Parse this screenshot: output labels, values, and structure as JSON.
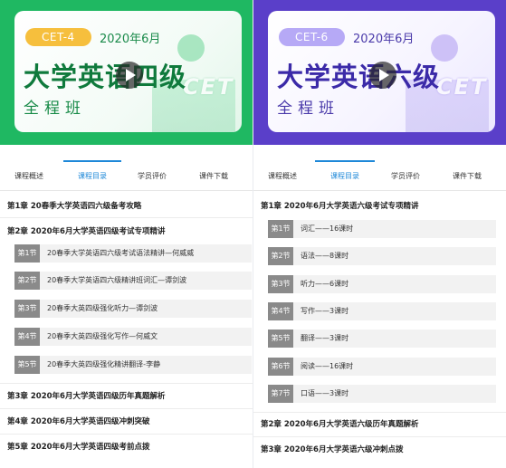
{
  "left": {
    "banner": {
      "level": "CET-4",
      "date": "2020年6月",
      "title": "大学英语四级",
      "subtitle": "全程班",
      "watermark": "CET"
    },
    "tabs": [
      "课程概述",
      "课程目录",
      "学员评价",
      "课件下载"
    ],
    "active_tab": 1,
    "ch1": "第1章 20春季大学英语四六级备考攻略",
    "ch2": "第2章 2020年6月大学英语四级考试专项精讲",
    "lessons": [
      {
        "badge": "第1节",
        "text": "20春季大学英语四六级考试语法精讲—何威威"
      },
      {
        "badge": "第2节",
        "text": "20春季大学英语四六级精讲班词汇—谭剑波"
      },
      {
        "badge": "第3节",
        "text": "20春季大英四级强化听力—谭剑波"
      },
      {
        "badge": "第4节",
        "text": "20春季大英四级强化写作—何威文"
      },
      {
        "badge": "第5节",
        "text": "20春季大英四级强化精讲翻译-李静"
      }
    ],
    "ch3": "第3章 2020年6月大学英语四级历年真题解析",
    "ch4": "第4章 2020年6月大学英语四级冲刺突破",
    "ch5": "第5章 2020年6月大学英语四级考前点拨"
  },
  "right": {
    "banner": {
      "level": "CET-6",
      "date": "2020年6月",
      "title": "大学英语六级",
      "subtitle": "全程班",
      "watermark": "CET"
    },
    "tabs": [
      "课程概述",
      "课程目录",
      "学员评价",
      "课件下载"
    ],
    "active_tab": 1,
    "ch1": "第1章 2020年6月大学英语六级考试专项精讲",
    "lessons": [
      {
        "badge": "第1节",
        "text": "词汇——16课时"
      },
      {
        "badge": "第2节",
        "text": "语法——8课时"
      },
      {
        "badge": "第3节",
        "text": "听力——6课时"
      },
      {
        "badge": "第4节",
        "text": "写作——3课时"
      },
      {
        "badge": "第5节",
        "text": "翻译——3课时"
      },
      {
        "badge": "第6节",
        "text": "阅读——16课时"
      },
      {
        "badge": "第7节",
        "text": "口语——3课时"
      }
    ],
    "ch2": "第2章 2020年6月大学英语六级历年真题解析",
    "ch3": "第3章 2020年6月大学英语六级冲刺点拨"
  },
  "colors": {
    "cet4_green": "#1fb862",
    "cet6_purple": "#5a3fc9",
    "tab_active": "#1e88d8",
    "badge_gray": "#8a8a8a"
  }
}
